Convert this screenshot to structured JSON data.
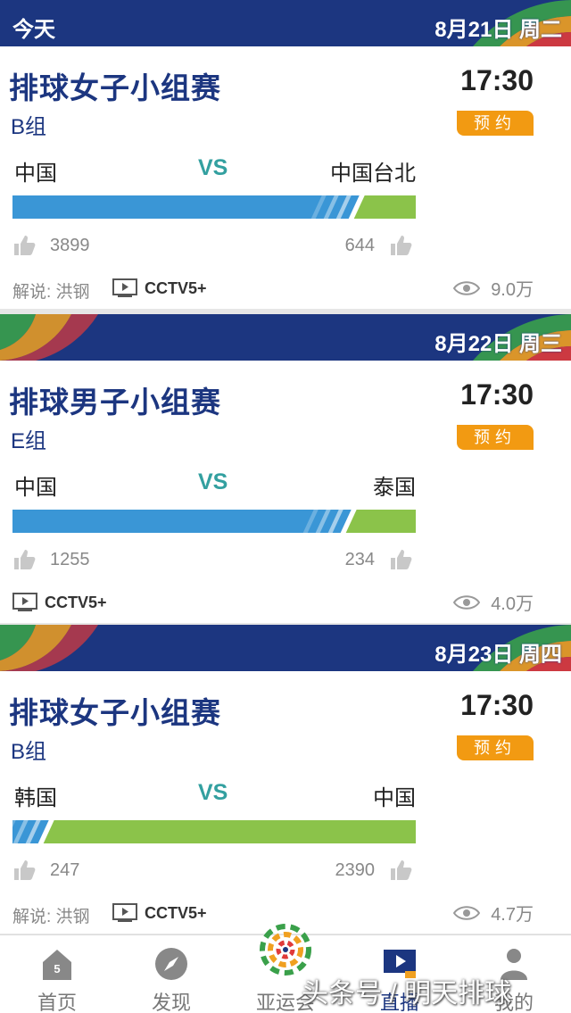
{
  "sections": [
    {
      "today_label": "今天",
      "date": "8月21日 周二",
      "event": "排球女子小组赛",
      "group": "B组",
      "time": "17:30",
      "reserve": "预约",
      "team_left": "中国",
      "vs": "VS",
      "team_right": "中国台北",
      "likes_left": "3899",
      "likes_right": "644",
      "support_left_fraction": 0.86,
      "commentary": "解说: 洪钢",
      "channel": "CCTV5+",
      "views": "9.0万"
    },
    {
      "today_label": "",
      "date": "8月22日 周三",
      "event": "排球男子小组赛",
      "group": "E组",
      "time": "17:30",
      "reserve": "预约",
      "team_left": "中国",
      "vs": "VS",
      "team_right": "泰国",
      "likes_left": "1255",
      "likes_right": "234",
      "support_left_fraction": 0.84,
      "commentary": "",
      "channel": "CCTV5+",
      "views": "4.0万"
    },
    {
      "today_label": "",
      "date": "8月23日 周四",
      "event": "排球女子小组赛",
      "group": "B组",
      "time": "17:30",
      "reserve": "预约",
      "team_left": "韩国",
      "vs": "VS",
      "team_right": "中国",
      "likes_left": "247",
      "likes_right": "2390",
      "support_left_fraction": 0.09,
      "commentary": "解说: 洪钢",
      "channel": "CCTV5+",
      "views": "4.7万"
    }
  ],
  "tabbar": {
    "tabs": [
      {
        "label": "首页",
        "icon": "home-icon",
        "badge": "5"
      },
      {
        "label": "发现",
        "icon": "compass-icon"
      },
      {
        "label": "亚运会",
        "icon": "asian-games-logo-icon"
      },
      {
        "label": "直播",
        "icon": "live-tv-icon",
        "active": true
      },
      {
        "label": "我的",
        "icon": "person-icon"
      }
    ]
  },
  "watermark": "头条号 / 明天排球",
  "colors": {
    "navy": "#1c3680",
    "orange": "#f29a12",
    "blue_bar": "#3a96d6",
    "green_bar": "#8bc34a",
    "vs_teal": "#33a0a0"
  }
}
